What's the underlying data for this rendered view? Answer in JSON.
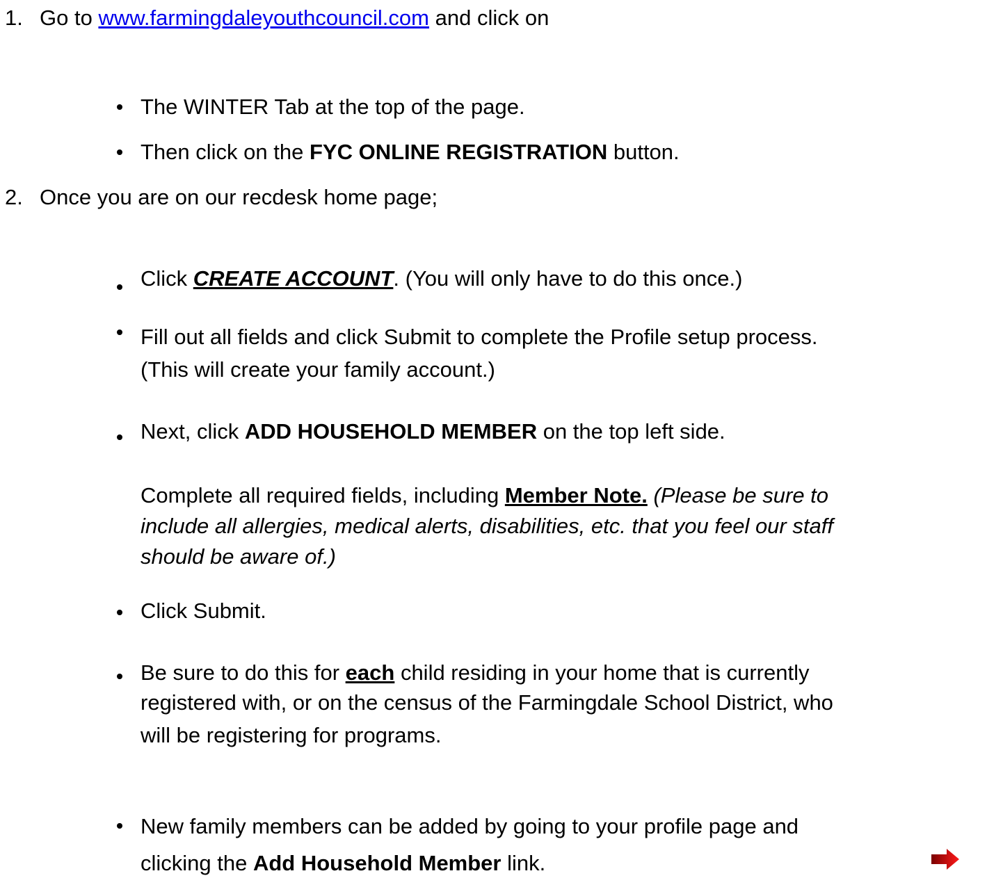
{
  "steps": [
    {
      "number": "1.",
      "intro": {
        "before": "Go to ",
        "link": "www.farmingdaleyouthcouncil.com",
        "after": " and click on"
      },
      "bullets": [
        {
          "text": "The WINTER Tab at the top of the page."
        },
        {
          "before": "Then click on the ",
          "bold": "FYC ONLINE REGISTRATION",
          "after": " button."
        }
      ]
    },
    {
      "number": "2.",
      "intro": {
        "text": "Once you are on our recdesk home page;"
      },
      "bullets": [
        {
          "before": "Click ",
          "emph": "CREATE ACCOUNT",
          "after": ".  (You will only have to do this once.)"
        },
        {
          "line1": "Fill out all fields and click Submit to complete the Profile setup process.",
          "line2": "(This will create your family account.)"
        },
        {
          "before": "Next, click ",
          "bold": "ADD HOUSEHOLD MEMBER",
          "after": " on the top left side."
        },
        {
          "para_before": "Complete all required fields, including ",
          "para_bold": "Member Note.",
          "para_italic_1": " (Please be sure to",
          "para_italic_2": "include all allergies, medical alerts, disabilities, etc. that you feel our staff",
          "para_italic_3": "should be aware of.)"
        },
        {
          "text": "Click Submit."
        },
        {
          "before": "Be sure to do this for ",
          "bold": "each",
          "after": " child residing in your home that is currently",
          "line2": "registered with, or on the census of the Farmingdale School District, who",
          "line3": "will be registering for programs."
        },
        {
          "line1": "New family members can be added by going to your profile page and",
          "before": "clicking the ",
          "bold": "Add Household Member",
          "after": " link."
        }
      ]
    }
  ],
  "colors": {
    "link": "#0000ee",
    "arrow": "#cc0000"
  },
  "icons": {
    "next_page": "red-arrow-right-icon"
  }
}
